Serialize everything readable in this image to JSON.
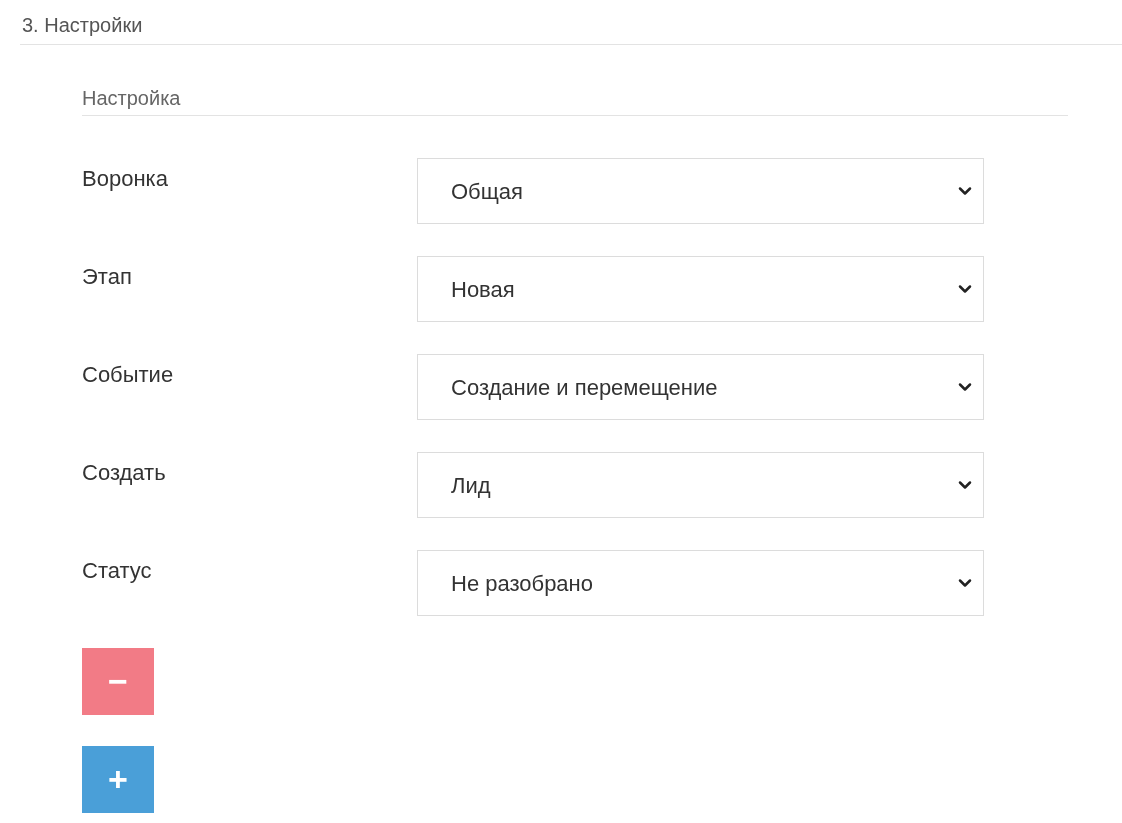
{
  "section_title": "3. Настройки",
  "subsection_title": "Настройка",
  "fields": [
    {
      "label": "Воронка",
      "value": "Общая"
    },
    {
      "label": "Этап",
      "value": "Новая"
    },
    {
      "label": "Событие",
      "value": "Создание и перемещение"
    },
    {
      "label": "Создать",
      "value": "Лид"
    },
    {
      "label": "Статус",
      "value": "Не разобрано"
    }
  ],
  "buttons": [
    {
      "kind": "remove",
      "label": "−"
    },
    {
      "kind": "add",
      "label": "+"
    }
  ]
}
